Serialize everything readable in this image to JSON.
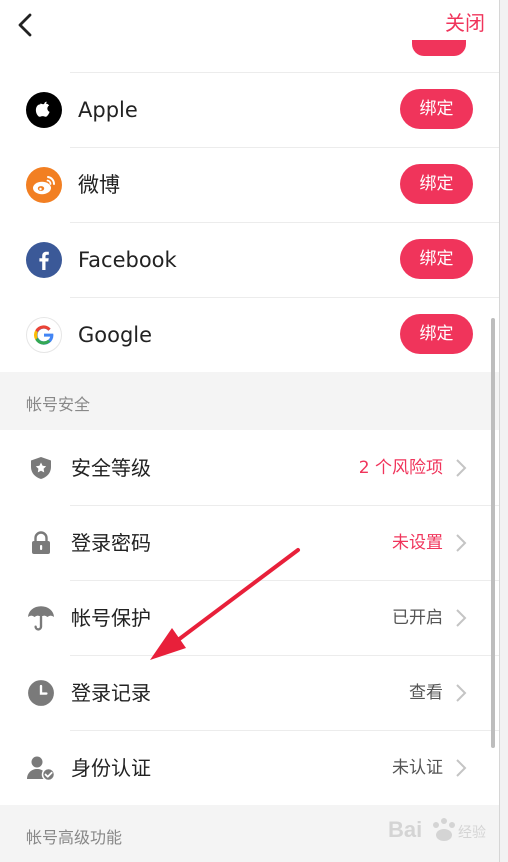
{
  "header": {
    "close_label": "关闭"
  },
  "bindings": {
    "button_label": "绑定",
    "items": [
      {
        "name": "Apple"
      },
      {
        "name": "微博"
      },
      {
        "name": "Facebook"
      },
      {
        "name": "Google"
      }
    ]
  },
  "security_section": {
    "title": "帐号安全",
    "items": [
      {
        "label": "安全等级",
        "value": "2 个风险项",
        "value_color": "#f0345b",
        "icon": "shield-icon"
      },
      {
        "label": "登录密码",
        "value": "未设置",
        "value_color": "#f0345b",
        "icon": "lock-icon"
      },
      {
        "label": "帐号保护",
        "value": "已开启",
        "icon": "umbrella-icon"
      },
      {
        "label": "登录记录",
        "value": "查看",
        "icon": "clock-icon"
      },
      {
        "label": "身份认证",
        "value": "未认证",
        "icon": "user-verified-icon"
      }
    ]
  },
  "advanced_section": {
    "title": "帐号高级功能"
  },
  "watermark": {
    "text": "Bai 经验"
  },
  "colors": {
    "accent": "#f0345b",
    "section_bg": "#f4f4f4",
    "icon_gray": "#7a7a7a"
  }
}
